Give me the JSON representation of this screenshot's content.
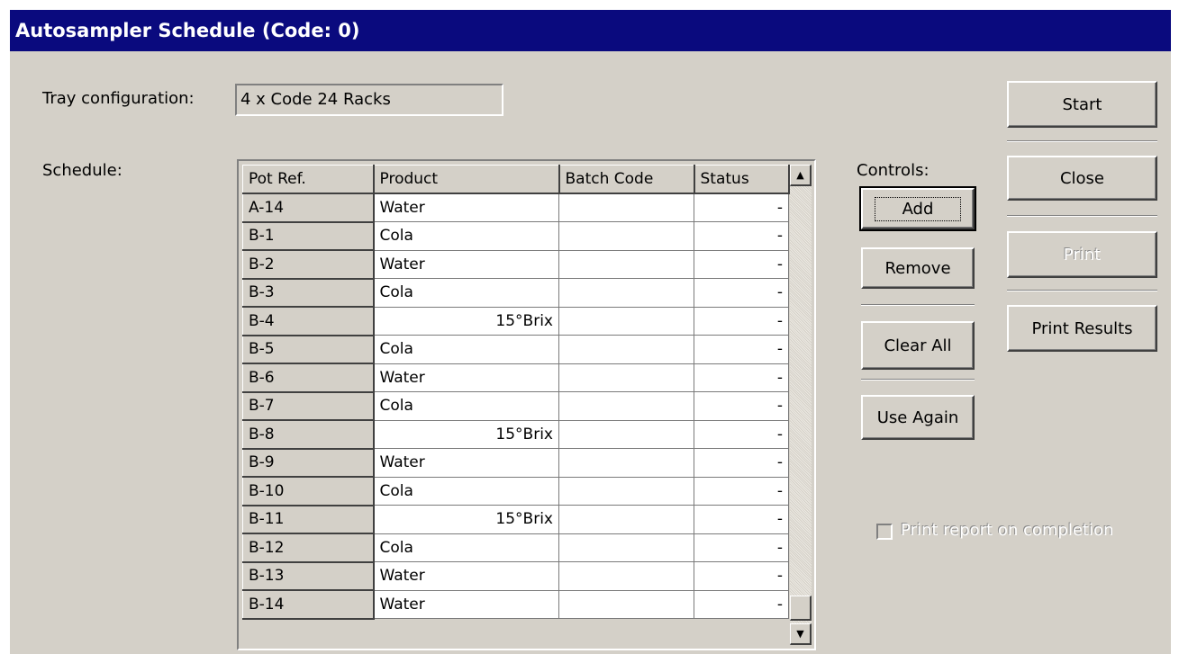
{
  "window": {
    "title": "Autosampler Schedule (Code: 0)"
  },
  "tray": {
    "label": "Tray configuration:",
    "value": "4 x Code 24 Racks"
  },
  "schedule": {
    "label": "Schedule:",
    "columns": [
      "Pot Ref.",
      "Product",
      "Batch Code",
      "Status"
    ],
    "rows": [
      {
        "ref": "A-14",
        "product": "Water",
        "batch": "",
        "status": "-"
      },
      {
        "ref": "B-1",
        "product": "Cola",
        "batch": "",
        "status": "-"
      },
      {
        "ref": "B-2",
        "product": "Water",
        "batch": "",
        "status": "-"
      },
      {
        "ref": "B-3",
        "product": "Cola",
        "batch": "",
        "status": "-"
      },
      {
        "ref": "B-4",
        "product": "15°Brix",
        "batch": "",
        "status": "-"
      },
      {
        "ref": "B-5",
        "product": "Cola",
        "batch": "",
        "status": "-"
      },
      {
        "ref": "B-6",
        "product": "Water",
        "batch": "",
        "status": "-"
      },
      {
        "ref": "B-7",
        "product": "Cola",
        "batch": "",
        "status": "-"
      },
      {
        "ref": "B-8",
        "product": "15°Brix",
        "batch": "",
        "status": "-"
      },
      {
        "ref": "B-9",
        "product": "Water",
        "batch": "",
        "status": "-"
      },
      {
        "ref": "B-10",
        "product": "Cola",
        "batch": "",
        "status": "-"
      },
      {
        "ref": "B-11",
        "product": "15°Brix",
        "batch": "",
        "status": "-"
      },
      {
        "ref": "B-12",
        "product": "Cola",
        "batch": "",
        "status": "-"
      },
      {
        "ref": "B-13",
        "product": "Water",
        "batch": "",
        "status": "-"
      },
      {
        "ref": "B-14",
        "product": "Water",
        "batch": "",
        "status": "-"
      }
    ]
  },
  "controls": {
    "label": "Controls:",
    "add": "Add",
    "remove": "Remove",
    "clear_all": "Clear All",
    "use_again": "Use Again"
  },
  "actions": {
    "start": "Start",
    "close": "Close",
    "print": "Print",
    "print_results": "Print Results"
  },
  "print_report": {
    "label": "Print report on completion",
    "checked": false,
    "enabled": false
  },
  "icons": {
    "scroll_up": "up-arrow-icon",
    "scroll_down": "down-arrow-icon"
  },
  "colors": {
    "titlebar": "#0a0a7e",
    "face": "#d4d0c8"
  }
}
